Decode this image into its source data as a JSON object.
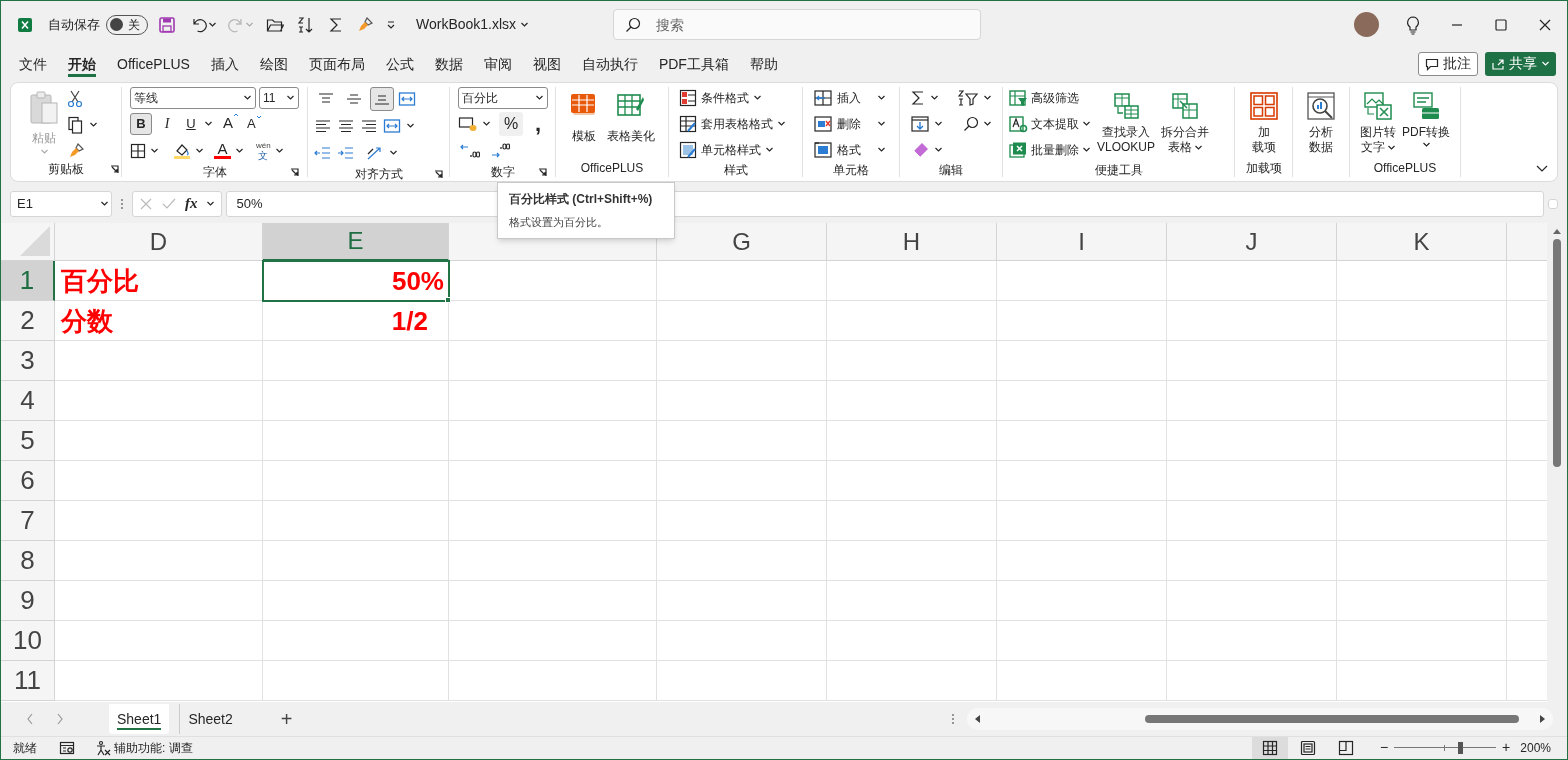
{
  "title_bar": {
    "autosave_label": "自动保存",
    "autosave": {
      "on": false,
      "label": "关"
    },
    "filename": "WorkBook1.xlsx",
    "search_placeholder": "搜索"
  },
  "menu_tabs": [
    {
      "label": "文件",
      "selected": false
    },
    {
      "label": "开始",
      "selected": true
    },
    {
      "label": "OfficePLUS",
      "selected": false
    },
    {
      "label": "插入",
      "selected": false
    },
    {
      "label": "绘图",
      "selected": false
    },
    {
      "label": "页面布局",
      "selected": false
    },
    {
      "label": "公式",
      "selected": false
    },
    {
      "label": "数据",
      "selected": false
    },
    {
      "label": "审阅",
      "selected": false
    },
    {
      "label": "视图",
      "selected": false
    },
    {
      "label": "自动执行",
      "selected": false
    },
    {
      "label": "PDF工具箱",
      "selected": false
    },
    {
      "label": "帮助",
      "selected": false
    }
  ],
  "comment_button": "批注",
  "share_button": "共享",
  "ribbon": {
    "clipboard": {
      "label": "剪贴板",
      "paste": "粘贴"
    },
    "font": {
      "label": "字体",
      "font_name": "等线",
      "font_size": "11",
      "bold": {
        "glyph": "B",
        "on": true
      },
      "italic": "I",
      "underline": "U",
      "grow": "A",
      "shrink": "A",
      "font_color": "A",
      "phonetic": "wén",
      "phonetic_char": "文"
    },
    "alignment": {
      "label": "对齐方式",
      "vertical_align": [
        {
          "selected": false
        },
        {
          "selected": false
        },
        {
          "selected": true
        }
      ]
    },
    "number": {
      "label": "数字",
      "format": "百分比",
      "percent": {
        "glyph": "%",
        "hovered": true
      },
      "comma": ","
    },
    "officeplus": {
      "label": "OfficePLUS",
      "buttons": [
        "模板",
        "表格美化"
      ]
    },
    "styles": {
      "label": "样式",
      "buttons": [
        "条件格式",
        "套用表格格式",
        "单元格样式"
      ]
    },
    "cells": {
      "label": "单元格",
      "buttons": [
        "插入",
        "删除",
        "格式"
      ]
    },
    "editing": {
      "label": "编辑"
    },
    "quick_tools": {
      "label": "便捷工具",
      "small": [
        "高级筛选",
        "文本提取",
        "批量删除"
      ],
      "large": [
        [
          "查找录入",
          "VLOOKUP"
        ],
        [
          "拆分合并",
          "表格"
        ]
      ]
    },
    "addins": {
      "label": "加载项",
      "button": [
        "加",
        "载项"
      ]
    },
    "analysis": {
      "button": [
        "分析",
        "数据"
      ]
    },
    "officeplus_tools": {
      "label": "OfficePLUS",
      "buttons": [
        [
          "图片转",
          "文字"
        ],
        [
          "PDF转换"
        ]
      ]
    }
  },
  "formula_bar": {
    "name_box": "E1",
    "function_glyph": "fx",
    "formula": "50%"
  },
  "tooltip": {
    "title": "百分比样式 (Ctrl+Shift+%)",
    "description": "格式设置为百分比。"
  },
  "columns": [
    {
      "label": "D",
      "selected": false
    },
    {
      "label": "E",
      "selected": true
    },
    {
      "selected": false
    },
    {
      "label": "G",
      "selected": false
    },
    {
      "label": "H",
      "selected": false
    },
    {
      "label": "I",
      "selected": false
    },
    {
      "label": "J",
      "selected": false
    },
    {
      "label": "K",
      "selected": false
    }
  ],
  "rows": [
    {
      "header": "1",
      "selected": true,
      "cells": [
        {
          "text": "百分比",
          "selected": false
        },
        {
          "text": "50%",
          "selected": true
        }
      ]
    },
    {
      "header": "2",
      "selected": false,
      "cells": [
        {
          "text": "分数",
          "selected": false
        },
        {
          "text": "1/2",
          "selected": false
        }
      ]
    },
    {
      "header": "3",
      "selected": false
    },
    {
      "header": "4",
      "selected": false
    },
    {
      "header": "5",
      "selected": false
    },
    {
      "header": "6",
      "selected": false
    },
    {
      "header": "7",
      "selected": false
    },
    {
      "header": "8",
      "selected": false
    },
    {
      "header": "9",
      "selected": false
    },
    {
      "header": "10",
      "selected": false
    },
    {
      "header": "11",
      "selected": false
    }
  ],
  "sheet_tabs": [
    {
      "label": "Sheet1",
      "selected": true
    },
    {
      "label": "Sheet2",
      "selected": false
    }
  ],
  "add_sheet": "+",
  "status_bar": {
    "ready": "就绪",
    "accessibility": "辅助功能: 调查",
    "views": [
      {
        "selected": true
      },
      {
        "selected": false
      },
      {
        "selected": false
      }
    ],
    "zoom_out": "−",
    "zoom_in": "+",
    "zoom": {
      "level": 0.66
    },
    "zoom_label": "200%"
  }
}
